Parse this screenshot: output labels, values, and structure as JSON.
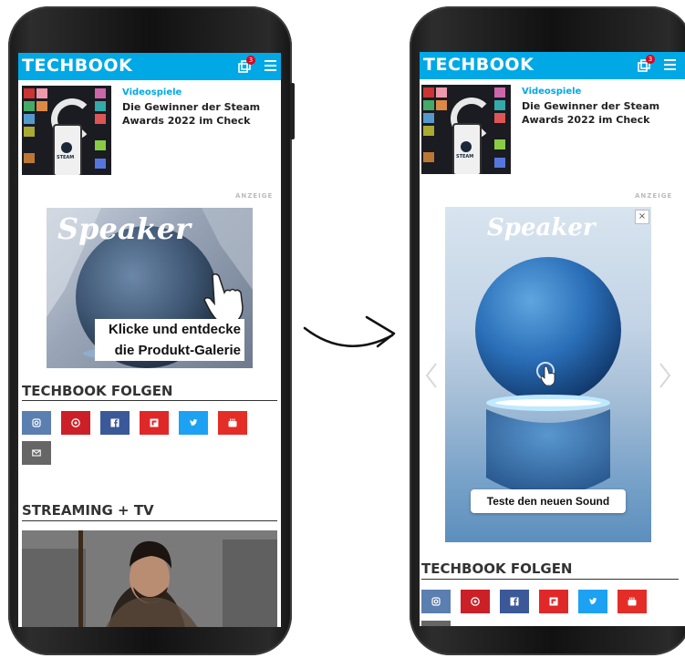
{
  "left": {
    "logo": "TECHBOOK",
    "notification_count": "3",
    "article": {
      "kicker": "Videospiele",
      "headline": "Die Gewinner der Steam Awards 2022 im Check",
      "thumb_text": "STEAM"
    },
    "ad_label": "ANZEIGE",
    "ad": {
      "brand": "Speaker",
      "cta_line1": "Klicke und entdecke",
      "cta_line2": "die Produkt-Galerie"
    },
    "follow_title": "TECHBOOK FOLGEN",
    "streaming_title": "STREAMING + TV"
  },
  "right": {
    "logo": "TECHBOOK",
    "notification_count": "3",
    "article": {
      "kicker": "Videospiele",
      "headline": "Die Gewinner der Steam Awards 2022 im Check",
      "thumb_text": "STEAM"
    },
    "ad_label": "ANZEIGE",
    "ad": {
      "brand": "Speaker",
      "cta": "Teste den neuen Sound",
      "close": "×"
    },
    "follow_title": "TECHBOOK FOLGEN"
  },
  "social_icons": [
    {
      "name": "instagram-icon",
      "color": "#5a7fb0"
    },
    {
      "name": "pinterest-icon",
      "color": "#cb2027"
    },
    {
      "name": "facebook-icon",
      "color": "#3b5998"
    },
    {
      "name": "flipboard-icon",
      "color": "#e12828"
    },
    {
      "name": "twitter-icon",
      "color": "#1da1f2"
    },
    {
      "name": "youtube-icon",
      "color": "#e52d27"
    },
    {
      "name": "email-icon",
      "color": "#666666"
    }
  ],
  "colors": {
    "brand": "#00a8e6",
    "badge": "#e2001a"
  }
}
